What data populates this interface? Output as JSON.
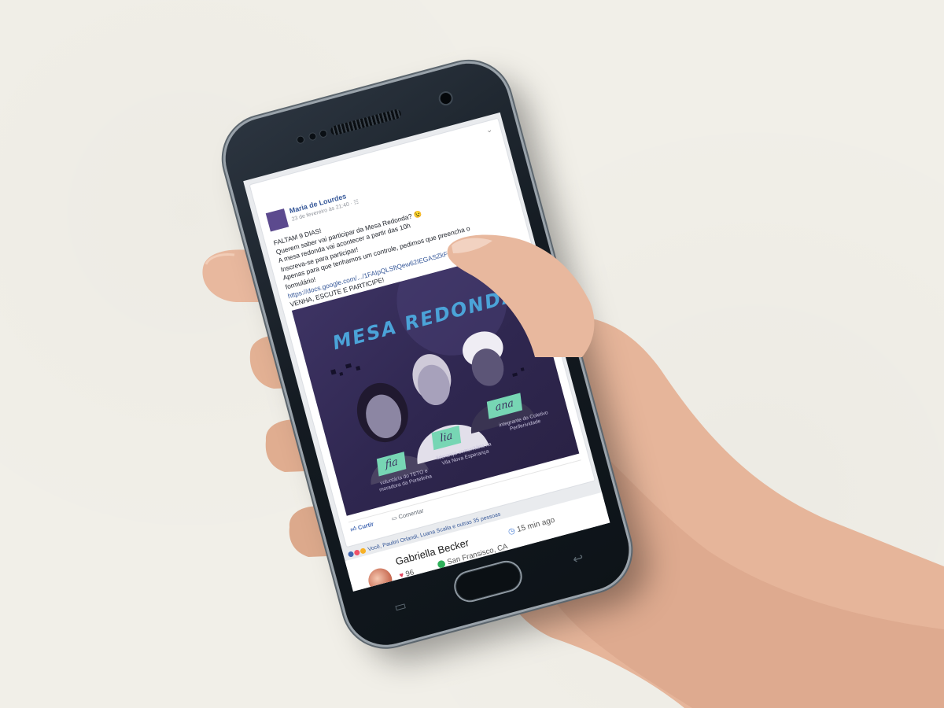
{
  "post": {
    "author": "Maria de Lourdes",
    "meta": "23 de fevereiro às 21:40 · ☷",
    "lines": [
      "FALTAM 9 DIAS!",
      "Querem saber vai participar da Mesa Redonda? 😉",
      "A mesa redonda vai acontecer a partir das 10h",
      "Inscreva-se para participar!",
      "Apenas para que tenhamos um controle, pedimos que preencha o",
      "formulário!",
      "VENHA, ESCUTE E PARTICIPE!"
    ],
    "link": "https://docs.google.com/.../1FAIpQLSftQew62IEGASZkFx.../viewform",
    "poster": {
      "title": "MESA REDONDA",
      "people": [
        {
          "name": "fia",
          "caption": "voluntária do TETO e moradora da Portelinha"
        },
        {
          "name": "lia",
          "caption": "liderança comunitária na Vila Nova Esperança"
        },
        {
          "name": "ana",
          "caption": "integrante do Coletivo Periferividade"
        }
      ]
    },
    "actions": {
      "like": "Curtir",
      "comment": "Comentar"
    },
    "reactions": "Você, Paulini Orlandi, Luana Scalla e outras 35 pessoas"
  },
  "feed_item": {
    "name": "Gabriella Becker",
    "time": "15 min ago",
    "location": "San Fransisco, CA",
    "likes": "96"
  },
  "colors": {
    "background": "#f1efe8",
    "phone_body": "#141b22",
    "fb_blue": "#365899",
    "poster_bg": "#2f2750",
    "poster_accent": "#77d6b4",
    "poster_title": "#4ba3d8"
  }
}
